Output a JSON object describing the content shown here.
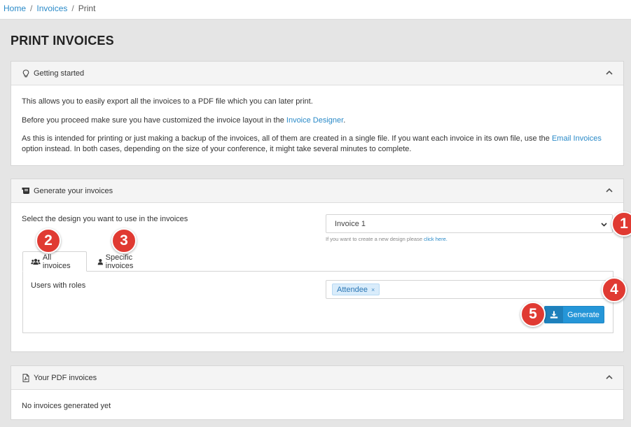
{
  "breadcrumb": {
    "items": [
      "Home",
      "Invoices",
      "Print"
    ],
    "sep": "/"
  },
  "page_title": "PRINT INVOICES",
  "getting_started": {
    "title": "Getting started",
    "para1": "This allows you to easily export all the invoices to a PDF file which you can later print.",
    "para2_before": "Before you proceed make sure you have customized the invoice layout in the ",
    "para2_link": "Invoice Designer",
    "para2_after": ".",
    "para3_before": "As this is intended for printing or just making a backup of the invoices, all of them are created in a single file. If you want each invoice in its own file, use the ",
    "para3_link": "Email Invoices",
    "para3_after": " option instead. In both cases, depending on the size of your conference, it might take several minutes to complete."
  },
  "generate": {
    "title": "Generate your invoices",
    "select_label": "Select the design you want to use in the invoices",
    "select_value": "Invoice 1",
    "hint_before": "If you want to create a new design please ",
    "hint_link": "click here.",
    "tabs": [
      "All invoices",
      "Specific invoices"
    ],
    "roles_label": "Users with roles",
    "tags": [
      "Attendee"
    ],
    "tag_remove": "×",
    "button": "Generate"
  },
  "pdf": {
    "title": "Your PDF invoices",
    "empty": "No invoices generated yet"
  },
  "callouts": [
    "1",
    "2",
    "3",
    "4",
    "5"
  ],
  "colors": {
    "accent": "#2596d8",
    "callout": "#e03a32",
    "link": "#2a8ac8"
  }
}
